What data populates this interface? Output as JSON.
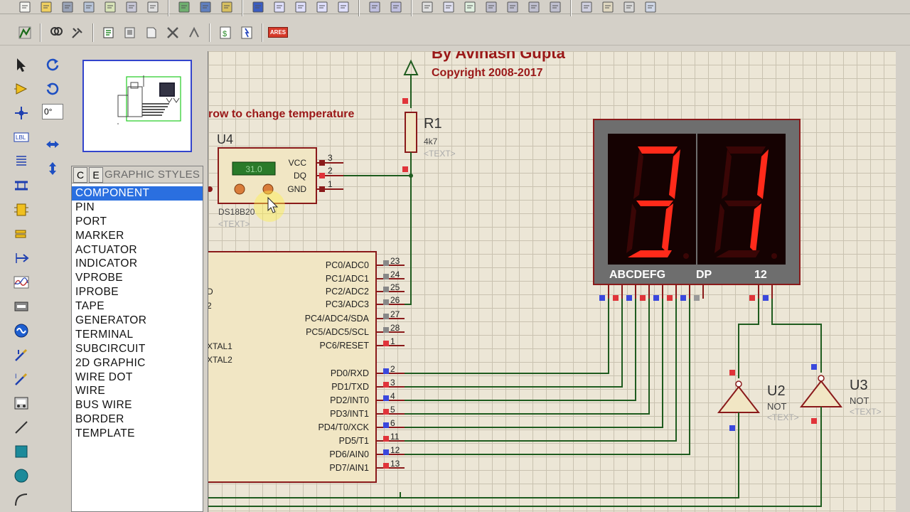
{
  "header": {
    "author": "By Avinash Gupta",
    "copyright": "Copyright 2008-2017",
    "instruction": "row to change temperature"
  },
  "toolbar": {
    "row1_icons": [
      "new-icon",
      "open-icon",
      "save-icon",
      "import-icon",
      "export-icon",
      "print-icon",
      "area-icon",
      "refresh-icon",
      "grid-icon",
      "origin-icon",
      "pan-icon",
      "zoom-in-icon",
      "zoom-out-icon",
      "zoom-all-icon",
      "zoom-area-icon",
      "undo-icon",
      "redo-icon",
      "cut-icon",
      "copy-icon",
      "paste-icon",
      "block-copy-icon",
      "block-move-icon",
      "block-rotate-icon",
      "block-delete-icon",
      "pick-icon",
      "make-device-icon",
      "package-icon",
      "decompose-icon"
    ],
    "row2_icons": [
      "wire-autorouter-icon",
      "search-icon",
      "property-tool-icon",
      "netlist-icon",
      "design-explorer-icon",
      "new-sheet-icon",
      "remove-sheet-icon",
      "exit-to-parent-icon",
      "bill-of-materials-icon",
      "electrical-rule-check-icon"
    ],
    "ares_label": "ARES"
  },
  "left_tools": {
    "icons": [
      "selection-mode-icon",
      "component-mode-icon",
      "junction-dot-icon",
      "wire-label-icon",
      "text-script-icon",
      "buses-icon",
      "subcircuit-icon",
      "terminals-icon",
      "device-pins-icon",
      "graph-icon",
      "tape-recorder-icon",
      "generator-icon",
      "voltage-probe-icon",
      "current-probe-icon",
      "virtual-instruments-icon",
      "line-icon",
      "box-icon",
      "circle-icon",
      "arc-icon"
    ],
    "pin_label": "LBL"
  },
  "rotate_tools": {
    "angle": "0°",
    "icons": [
      "rotate-clockwise-icon",
      "rotate-anticlockwise-icon",
      "mirror-x-icon",
      "mirror-y-icon"
    ]
  },
  "selector": {
    "btn_c": "C",
    "btn_e": "E",
    "title": "GRAPHIC STYLES",
    "items": [
      "COMPONENT",
      "PIN",
      "PORT",
      "MARKER",
      "ACTUATOR",
      "INDICATOR",
      "VPROBE",
      "IPROBE",
      "TAPE",
      "GENERATOR",
      "TERMINAL",
      "SUBCIRCUIT",
      "2D GRAPHIC",
      "WIRE DOT",
      "WIRE",
      "BUS WIRE",
      "BORDER",
      "TEMPLATE"
    ],
    "selected": "COMPONENT"
  },
  "schematic": {
    "u4": {
      "ref": "U4",
      "part": "DS18B20",
      "reading": "31.0",
      "text": "<TEXT>",
      "pins": [
        "VCC",
        "DQ",
        "GND"
      ],
      "pin_numbers": [
        "3",
        "2",
        "1"
      ]
    },
    "r1": {
      "ref": "R1",
      "value": "4k7",
      "text": "<TEXT>"
    },
    "mcu": {
      "left_labels": [
        "D",
        "2",
        "XTAL1",
        "XTAL2"
      ],
      "right_pins": [
        {
          "label": "PC0/ADC0",
          "num": "23"
        },
        {
          "label": "PC1/ADC1",
          "num": "24"
        },
        {
          "label": "PC2/ADC2",
          "num": "25"
        },
        {
          "label": "PC3/ADC3",
          "num": "26"
        },
        {
          "label": "PC4/ADC4/SDA",
          "num": "27"
        },
        {
          "label": "PC5/ADC5/SCL",
          "num": "28"
        },
        {
          "label": "PC6/RESET",
          "num": "1"
        },
        {
          "label": "PD0/RXD",
          "num": "2"
        },
        {
          "label": "PD1/TXD",
          "num": "3"
        },
        {
          "label": "PD2/INT0",
          "num": "4"
        },
        {
          "label": "PD3/INT1",
          "num": "5"
        },
        {
          "label": "PD4/T0/XCK",
          "num": "6"
        },
        {
          "label": "PD5/T1",
          "num": "11"
        },
        {
          "label": "PD6/AIN0",
          "num": "12"
        },
        {
          "label": "PD7/AIN1",
          "num": "13"
        }
      ]
    },
    "display": {
      "digits": "31",
      "pins_label": "ABCDEFG",
      "dp_label": "DP",
      "com_label": "12",
      "on_color": "#ff2a1a",
      "off_color": "#3a0606"
    },
    "u2": {
      "ref": "U2",
      "type": "NOT",
      "text": "<TEXT>"
    },
    "u3": {
      "ref": "U3",
      "type": "NOT",
      "text": "<TEXT>"
    }
  },
  "colors": {
    "wire": "#1f5c1f",
    "component_outline": "#8a1a1a",
    "component_fill": "#f1e6c4",
    "pin_red": "#e0343a",
    "pin_blue": "#3a48dd",
    "text_red": "#9a1818",
    "canvas": "#ece6d6",
    "grid": "#c9c2b0",
    "selected": "#2a6fe0"
  }
}
